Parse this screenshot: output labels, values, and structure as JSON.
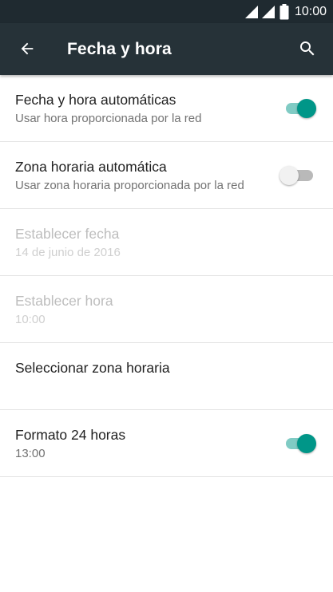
{
  "status_bar": {
    "time": "10:00"
  },
  "app_bar": {
    "title": "Fecha y hora"
  },
  "settings": [
    {
      "title": "Fecha y hora automáticas",
      "subtitle": "Usar hora proporcionada por la red",
      "toggle": "on",
      "enabled": true
    },
    {
      "title": "Zona horaria automática",
      "subtitle": "Usar zona horaria proporcionada por la red",
      "toggle": "off",
      "enabled": true
    },
    {
      "title": "Establecer fecha",
      "subtitle": "14 de junio de 2016",
      "enabled": false
    },
    {
      "title": "Establecer hora",
      "subtitle": "10:00",
      "enabled": false
    },
    {
      "title": "Seleccionar zona horaria",
      "subtitle": "",
      "enabled": true
    },
    {
      "title": "Formato 24 horas",
      "subtitle": "13:00",
      "toggle": "on",
      "enabled": true
    }
  ],
  "colors": {
    "status_bar_bg": "#1f2a30",
    "app_bar_bg": "#263238",
    "accent": "#009688",
    "accent_track": "#80cbc4"
  }
}
